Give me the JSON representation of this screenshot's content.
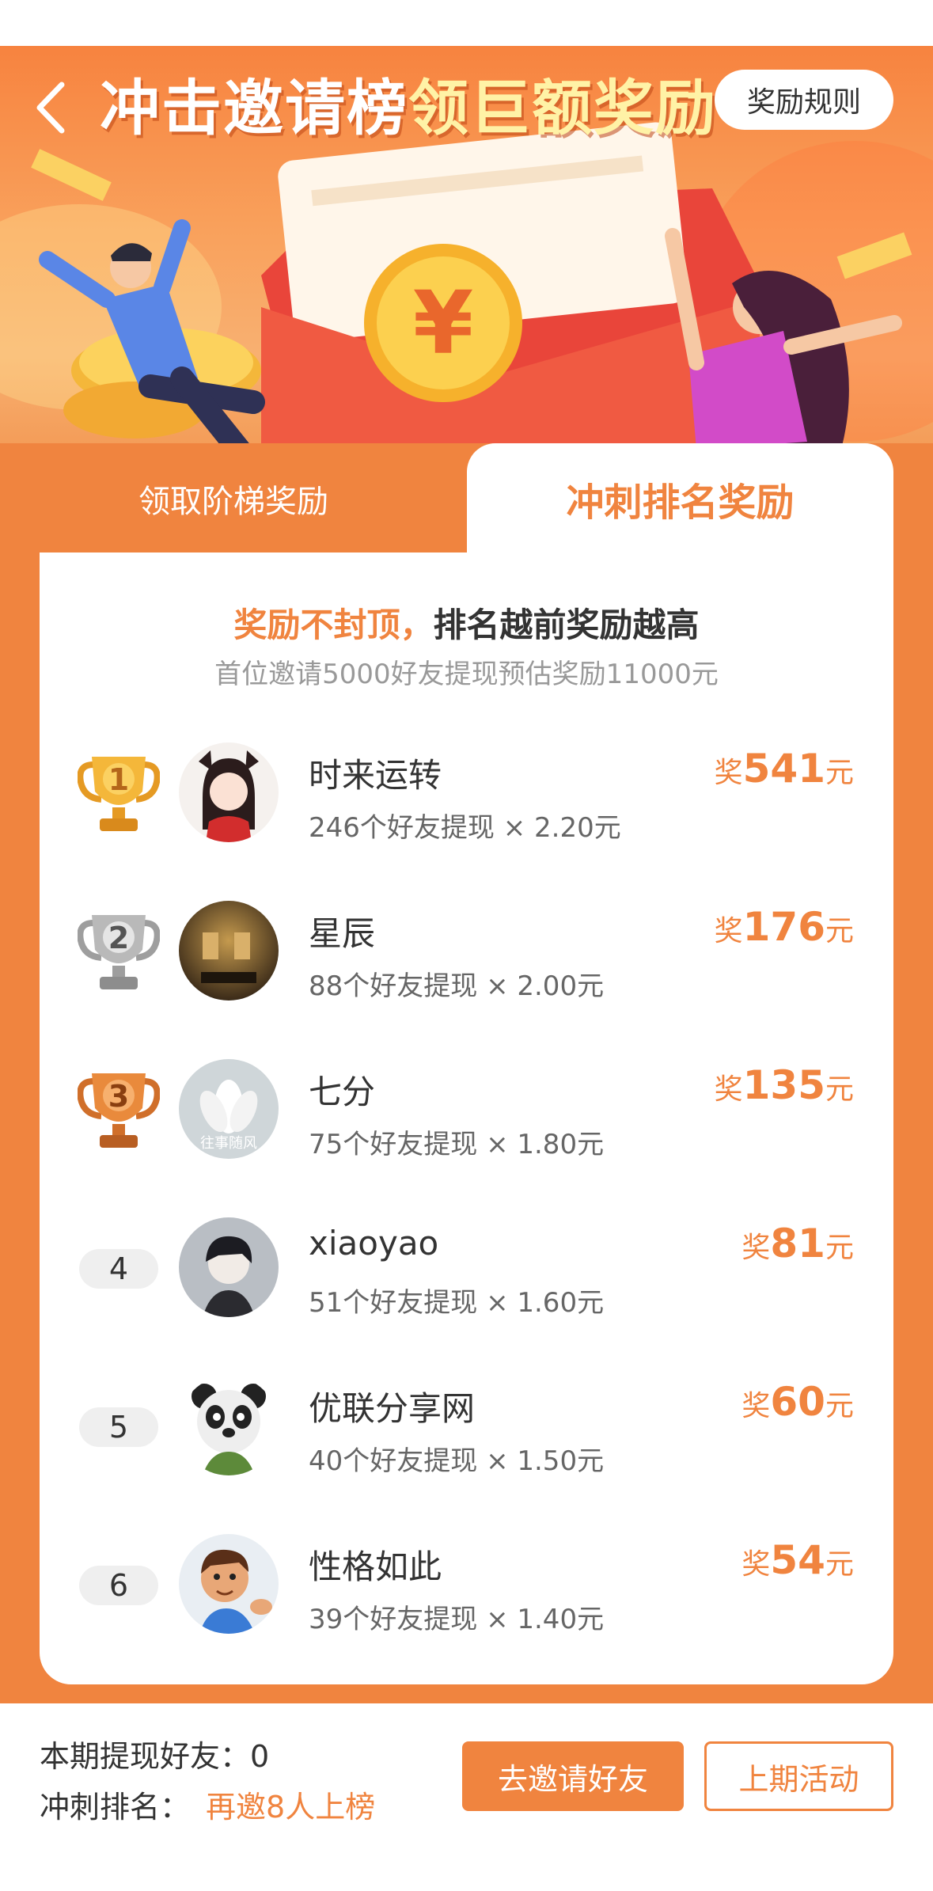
{
  "banner": {
    "title_part1": "冲击邀请榜",
    "title_part2": "领巨额奖励",
    "rules_label": "奖励规则",
    "coin_symbol": "¥"
  },
  "tabs": [
    {
      "label": "领取阶梯奖励",
      "active": false
    },
    {
      "label": "冲刺排名奖励",
      "active": true
    }
  ],
  "headline": {
    "orange": "奖励不封顶，",
    "dark": "排名越前奖励越高",
    "sub": "首位邀请5000好友提现预估奖励11000元"
  },
  "ranking": [
    {
      "rank": "1",
      "name": "时来运转",
      "detail": "246个好友提现 × 2.20元",
      "reward_prefix": "奖",
      "reward": "541",
      "reward_suffix": "元"
    },
    {
      "rank": "2",
      "name": "星辰",
      "detail": "88个好友提现 × 2.00元",
      "reward_prefix": "奖",
      "reward": "176",
      "reward_suffix": "元"
    },
    {
      "rank": "3",
      "name": "七分",
      "detail": "75个好友提现 × 1.80元",
      "reward_prefix": "奖",
      "reward": "135",
      "reward_suffix": "元"
    },
    {
      "rank": "4",
      "name": "xiaoyao",
      "detail": "51个好友提现 × 1.60元",
      "reward_prefix": "奖",
      "reward": "81",
      "reward_suffix": "元"
    },
    {
      "rank": "5",
      "name": "优联分享网",
      "detail": "40个好友提现 × 1.50元",
      "reward_prefix": "奖",
      "reward": "60",
      "reward_suffix": "元"
    },
    {
      "rank": "6",
      "name": "性格如此",
      "detail": "39个好友提现 × 1.40元",
      "reward_prefix": "奖",
      "reward": "54",
      "reward_suffix": "元"
    }
  ],
  "avatar_watermark": "往事随风",
  "footer": {
    "friends_label": "本期提现好友：0",
    "rank_label": "冲刺排名：",
    "rank_hint": "再邀8人上榜",
    "invite_label": "去邀请好友",
    "last_label": "上期活动"
  },
  "colors": {
    "accent": "#f0843f",
    "gold": "#f4b73a",
    "silver": "#b9b9b9",
    "bronze": "#e98a3c"
  }
}
